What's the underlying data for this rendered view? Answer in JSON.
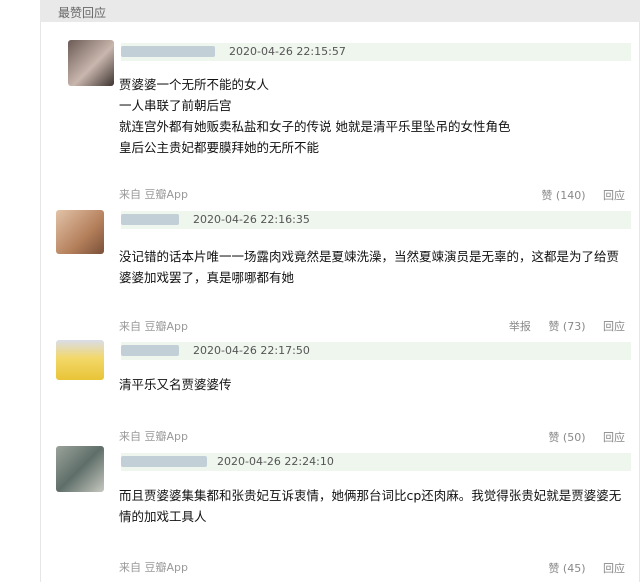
{
  "header": {
    "title": "最赞回应"
  },
  "comments": [
    {
      "time": "2020-04-26 22:15:57",
      "lines": [
        "贾婆婆一个无所不能的女人",
        "一人串联了前朝后宫",
        "就连宫外都有她贩卖私盐和女子的传说 她就是清平乐里坠吊的女性角色",
        "皇后公主贵妃都要膜拜她的无所不能"
      ],
      "source": "来自 豆瓣App",
      "report": "",
      "likes": "赞 (140)",
      "reply": "回应"
    },
    {
      "time": "2020-04-26 22:16:35",
      "lines": [
        "没记错的话本片唯一一场露肉戏竟然是夏竦洗澡，当然夏竦演员是无辜的，这都是为了给贾",
        "婆婆加戏罢了，真是哪哪都有她"
      ],
      "source": "来自 豆瓣App",
      "report": "举报",
      "likes": "赞 (73)",
      "reply": "回应"
    },
    {
      "time": "2020-04-26 22:17:50",
      "lines": [
        "清平乐又名贾婆婆传"
      ],
      "source": "来自 豆瓣App",
      "report": "",
      "likes": "赞 (50)",
      "reply": "回应"
    },
    {
      "time": "2020-04-26 22:24:10",
      "lines": [
        "而且贾婆婆集集都和张贵妃互诉衷情，她俩那台词比cp还肉麻。我觉得张贵妃就是贾婆婆无",
        "情的加戏工具人"
      ],
      "source": "来自 豆瓣App",
      "report": "",
      "likes": "赞 (45)",
      "reply": "回应"
    }
  ],
  "colors": {
    "accent": "#eef6ee",
    "text": "#111111",
    "muted": "#999999"
  }
}
